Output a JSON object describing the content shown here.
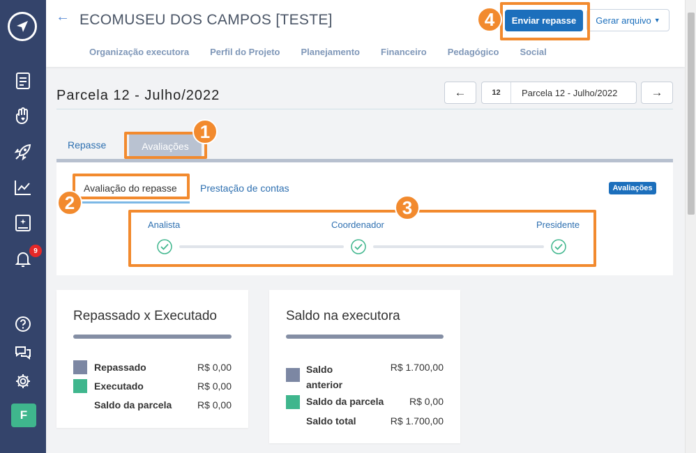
{
  "sidebar": {
    "badge_count": "9",
    "avatar_letter": "F"
  },
  "header": {
    "title": "ECOMUSEU DOS CAMPOS [TESTE]",
    "nav": [
      "Organização executora",
      "Perfil do Projeto",
      "Planejamento",
      "Financeiro",
      "Pedagógico",
      "Social"
    ],
    "send_button": "Enviar repasse",
    "generate_button": "Gerar arquivo"
  },
  "parcela": {
    "title": "Parcela 12 - Julho/2022",
    "number": "12",
    "select_label": "Parcela 12 - Julho/2022"
  },
  "tabs": {
    "repasse": "Repasse",
    "avaliacoes": "Avaliações"
  },
  "subtabs": {
    "avaliacao": "Avaliação do repasse",
    "prestacao": "Prestação de contas",
    "badge": "Avaliações"
  },
  "steps": [
    "Analista",
    "Coordenador",
    "Presidente"
  ],
  "annotations": [
    "1",
    "2",
    "3",
    "4"
  ],
  "cards": {
    "repassado": {
      "title": "Repassado x Executado",
      "rows": [
        {
          "label": "Repassado",
          "value": "R$ 0,00"
        },
        {
          "label": "Executado",
          "value": "R$ 0,00"
        },
        {
          "label": "Saldo da parcela",
          "value": "R$ 0,00"
        }
      ]
    },
    "saldo": {
      "title": "Saldo na executora",
      "rows": [
        {
          "label": "Saldo anterior",
          "value": "R$ 1.700,00"
        },
        {
          "label": "Saldo da parcela",
          "value": "R$ 0,00"
        },
        {
          "label": "Saldo total",
          "value": "R$ 1.700,00"
        }
      ]
    }
  },
  "colors": {
    "sidebar": "#34446b",
    "primary": "#1c6fbc",
    "accent_orange": "#f28a2e",
    "green": "#3fb68d",
    "gray_legend": "#7c87a3"
  }
}
